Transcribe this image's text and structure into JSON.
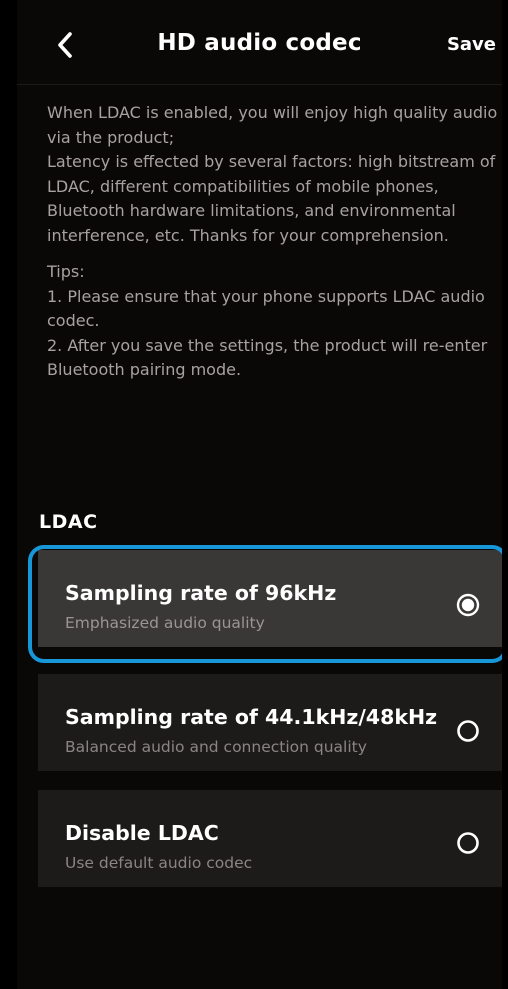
{
  "header": {
    "back_icon": "chevron-left-icon",
    "title": "HD audio codec",
    "save_label": "Save"
  },
  "description": {
    "line1": "When LDAC is enabled, you will enjoy high quality audio via the product;",
    "line2": "Latency is effected by several factors: high bitstream of LDAC, different compatibilities of mobile phones, Bluetooth hardware limitations, and environmental interference, etc. Thanks for your comprehension.",
    "tips_title": "Tips:",
    "tip1": "1. Please ensure that your phone supports LDAC audio codec.",
    "tip2": "2. After you save the settings, the product will re-enter Bluetooth pairing mode."
  },
  "ldac": {
    "section_label": "LDAC",
    "options": [
      {
        "title": "Sampling rate of 96kHz",
        "subtitle": "Emphasized audio quality",
        "selected": true
      },
      {
        "title": "Sampling rate of 44.1kHz/48kHz",
        "subtitle": "Balanced audio and connection quality",
        "selected": false
      },
      {
        "title": "Disable LDAC",
        "subtitle": "Use default audio codec",
        "selected": false
      }
    ]
  },
  "colors": {
    "background": "#0a0807",
    "card": "#1d1b1a",
    "card_selected": "#3a3837",
    "accent_ring": "#1796d8",
    "text_primary": "#ffffff",
    "text_secondary": "#a7a2a0"
  }
}
